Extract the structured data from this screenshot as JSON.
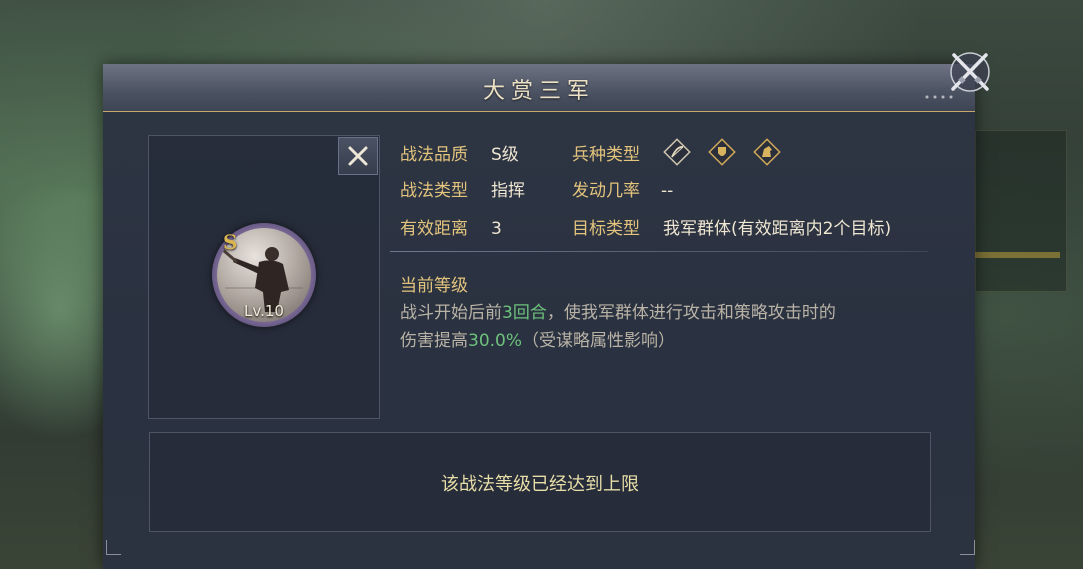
{
  "dialog": {
    "title": "大赏三军"
  },
  "skill": {
    "grade_letter": "S",
    "level": "Lv.10"
  },
  "attributes": {
    "quality_label": "战法品质",
    "quality_value": "S级",
    "type_label": "战法类型",
    "type_value": "指挥",
    "range_label": "有效距离",
    "range_value": "3",
    "troop_label": "兵种类型",
    "troop_icons": [
      "archer-icon",
      "shield-icon",
      "cavalry-icon"
    ],
    "trigger_label": "发动几率",
    "trigger_value": "--",
    "target_label": "目标类型",
    "target_value": "我军群体(有效距离内2个目标)"
  },
  "effect": {
    "heading": "当前等级",
    "line1_pre": "战斗开始后前",
    "line1_hl": "3回合",
    "line1_post": "，使我军群体进行攻击和策略攻击时的",
    "line2_pre": "伤害提高",
    "line2_hl": "30.0%",
    "line2_post": "（受谋略属性影响）"
  },
  "footer": {
    "status": "该战法等级已经达到上限"
  },
  "colors": {
    "label_gold": "#e3c47d",
    "highlight_green": "#6dc27c",
    "panel_bg": "#2e3543"
  }
}
